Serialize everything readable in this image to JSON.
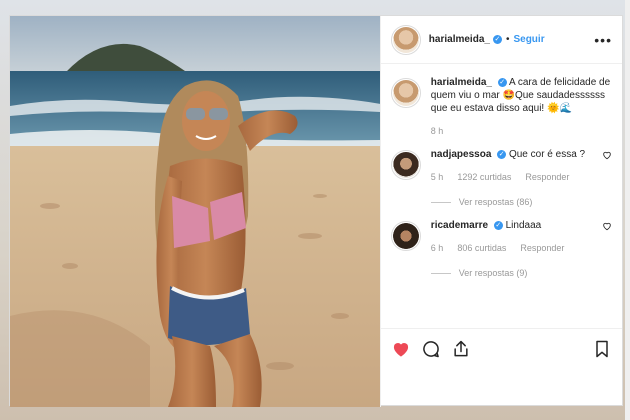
{
  "header": {
    "username": "harialmeida_",
    "separator": "•",
    "follow_label": "Seguir",
    "more_label": "•••",
    "verified_mark": "✓"
  },
  "caption": {
    "username": "harialmeida_",
    "text": "A cara de felicidade de quem viu o mar 🤩Que saudadessssss que eu estava disso aqui! 🌞🌊",
    "time": "8 h"
  },
  "comments": [
    {
      "username": "nadjapessoa",
      "text": "Que cor é essa ?",
      "time": "5 h",
      "likes": "1292 curtidas",
      "reply_label": "Responder",
      "view_replies": "Ver respostas (86)"
    },
    {
      "username": "ricademarre",
      "text": "Lindaaa",
      "time": "6 h",
      "likes": "806 curtidas",
      "reply_label": "Responder",
      "view_replies": "Ver respostas (9)"
    }
  ],
  "actions": {
    "icons": [
      "heart-icon",
      "comment-icon",
      "share-icon",
      "bookmark-icon"
    ],
    "like_color": "#ed4956"
  },
  "colors": {
    "accent": "#3897f0",
    "text": "#262626",
    "muted": "#999999"
  }
}
